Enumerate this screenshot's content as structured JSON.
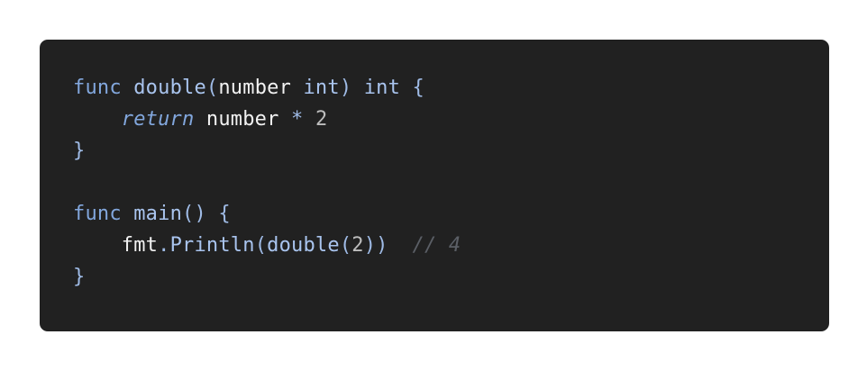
{
  "code": {
    "lines": [
      {
        "tokens": [
          {
            "kind": "kw",
            "text": "func"
          },
          {
            "kind": "ws",
            "text": " "
          },
          {
            "kind": "fn",
            "text": "double"
          },
          {
            "kind": "pn",
            "text": "("
          },
          {
            "kind": "id",
            "text": "number"
          },
          {
            "kind": "ws",
            "text": " "
          },
          {
            "kind": "ty",
            "text": "int"
          },
          {
            "kind": "pn",
            "text": ")"
          },
          {
            "kind": "ws",
            "text": " "
          },
          {
            "kind": "ty",
            "text": "int"
          },
          {
            "kind": "ws",
            "text": " "
          },
          {
            "kind": "pn",
            "text": "{"
          }
        ]
      },
      {
        "tokens": [
          {
            "kind": "ws",
            "text": "    "
          },
          {
            "kind": "ret",
            "text": "return"
          },
          {
            "kind": "ws",
            "text": " "
          },
          {
            "kind": "id",
            "text": "number"
          },
          {
            "kind": "ws",
            "text": " "
          },
          {
            "kind": "op",
            "text": "*"
          },
          {
            "kind": "ws",
            "text": " "
          },
          {
            "kind": "nu",
            "text": "2"
          }
        ]
      },
      {
        "tokens": [
          {
            "kind": "pn",
            "text": "}"
          }
        ]
      },
      {
        "tokens": []
      },
      {
        "tokens": [
          {
            "kind": "kw",
            "text": "func"
          },
          {
            "kind": "ws",
            "text": " "
          },
          {
            "kind": "fn",
            "text": "main"
          },
          {
            "kind": "pn",
            "text": "()"
          },
          {
            "kind": "ws",
            "text": " "
          },
          {
            "kind": "pn",
            "text": "{"
          }
        ]
      },
      {
        "tokens": [
          {
            "kind": "ws",
            "text": "    "
          },
          {
            "kind": "id",
            "text": "fmt"
          },
          {
            "kind": "pn",
            "text": "."
          },
          {
            "kind": "fn",
            "text": "Println"
          },
          {
            "kind": "pn",
            "text": "("
          },
          {
            "kind": "fn",
            "text": "double"
          },
          {
            "kind": "pn",
            "text": "("
          },
          {
            "kind": "nu",
            "text": "2"
          },
          {
            "kind": "pn",
            "text": "))"
          },
          {
            "kind": "ws",
            "text": "  "
          },
          {
            "kind": "cm",
            "text": "// 4"
          }
        ]
      },
      {
        "tokens": [
          {
            "kind": "pn",
            "text": "}"
          }
        ]
      }
    ]
  },
  "colors": {
    "background": "#212121",
    "keyword": "#82a7dd",
    "identifier": "#f2f2f2",
    "number": "#bdbdbd",
    "comment": "#5b5f66"
  }
}
